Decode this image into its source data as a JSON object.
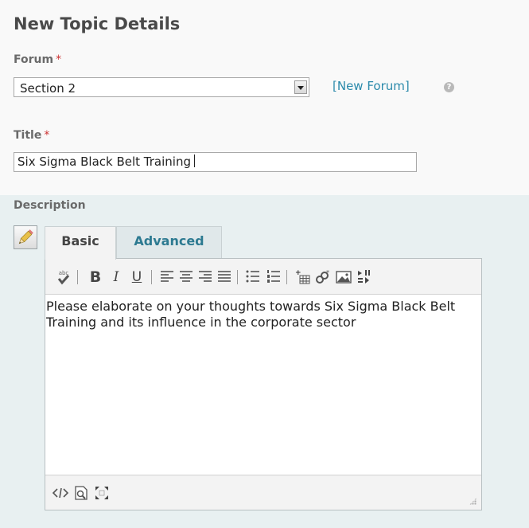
{
  "heading": "New Topic Details",
  "forum": {
    "label": "Forum",
    "required_mark": "*",
    "selected": "Section 2",
    "new_forum_link": "[New Forum]",
    "help_icon": "?"
  },
  "title_field": {
    "label": "Title",
    "required_mark": "*",
    "value": "Six Sigma Black Belt Training"
  },
  "description": {
    "label": "Description",
    "tabs": [
      {
        "label": "Basic",
        "active": true
      },
      {
        "label": "Advanced",
        "active": false
      }
    ],
    "toolbar": {
      "spellcheck": "abc",
      "bold": "B",
      "italic": "I",
      "underline": "U"
    },
    "content": "Please elaborate on your thoughts towards Six Sigma Black Belt Training and its influence in the corporate sector"
  },
  "colors": {
    "link": "#2b8aab",
    "required": "#cc3333",
    "panel_bg": "#e8f0f1"
  }
}
